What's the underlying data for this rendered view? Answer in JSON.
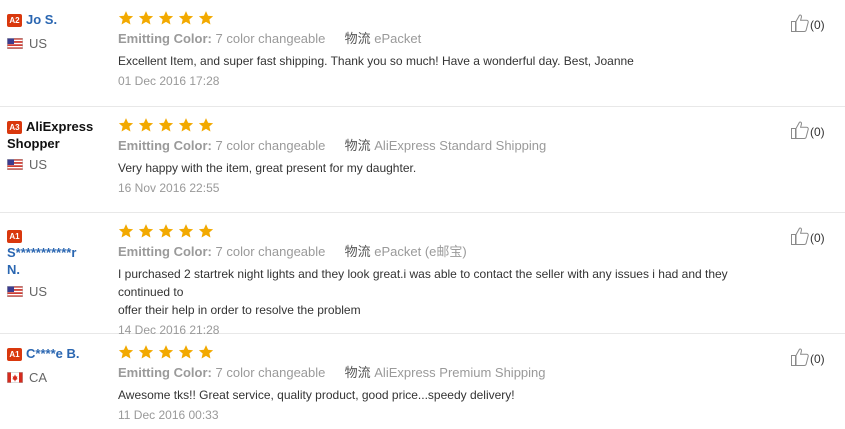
{
  "labels": {
    "emitting_color": "Emitting Color:",
    "logistics": "物流"
  },
  "reviews": [
    {
      "badge": "A2",
      "name_line1": "Jo S.",
      "name_line2": "",
      "country": "US",
      "rating": 5,
      "emitting_color": "7 color changeable",
      "shipping": "ePacket",
      "text_line1": "Excellent Item, and super fast shipping. Thank you so much! Have a wonderful day. Best, Joanne",
      "text_line2": "",
      "date": "01 Dec 2016 17:28",
      "likes": "(0)"
    },
    {
      "badge": "A3",
      "name_line1": "AliExpress",
      "name_line2": "Shopper",
      "country": "US",
      "rating": 5,
      "emitting_color": "7 color changeable",
      "shipping": "AliExpress Standard Shipping",
      "text_line1": "Very happy with the item, great present for my daughter.",
      "text_line2": "",
      "date": "16 Nov 2016 22:55",
      "likes": "(0)"
    },
    {
      "badge": "A1",
      "name_line1": "",
      "name_line2": "S***********r",
      "name_line3": "N.",
      "country": "US",
      "rating": 5,
      "emitting_color": "7 color changeable",
      "shipping": "ePacket (e邮宝)",
      "text_line1": "I purchased 2 startrek night lights and they look great.i was able to contact the seller with any issues i had and they continued to",
      "text_line2": "offer their help in order to resolve the problem",
      "date": "14 Dec 2016 21:28",
      "likes": "(0)"
    },
    {
      "badge": "A1",
      "name_line1": "C****e B.",
      "name_line2": "",
      "country": "CA",
      "rating": 5,
      "emitting_color": "7 color changeable",
      "shipping": "AliExpress Premium Shipping",
      "text_line1": "Awesome tks!! Great service, quality product, good price...speedy delivery!",
      "text_line2": "",
      "date": "11 Dec 2016 00:33",
      "likes": "(0)"
    }
  ],
  "colors": {
    "star": "#f2a900",
    "badge": "#d9380d",
    "username": "#2a66b1"
  },
  "icons": {
    "rating": "star-icon",
    "helpful": "thumbs-up-icon",
    "flag_us": "us-flag-icon",
    "flag_ca": "ca-flag-icon"
  }
}
